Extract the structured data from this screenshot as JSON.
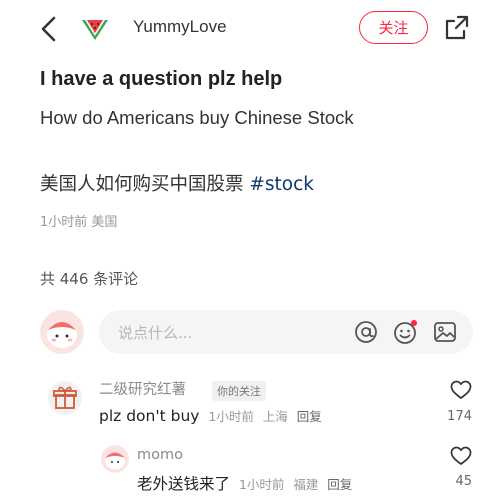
{
  "header": {
    "author_name": "YummyLove",
    "follow_label": "关注",
    "icons": [
      "chevron-left-icon",
      "watermelon-avatar",
      "share-icon"
    ]
  },
  "post": {
    "title": "I have a question plz help",
    "line1": "How do Americans buy Chinese Stock",
    "line2": "美国人如何购买中国股票",
    "hashtag": "#stock",
    "meta": "1小时前 美国"
  },
  "comments_section": {
    "count_label": "共 446 条评论",
    "input_placeholder": "说点什么...",
    "input_icons": [
      "at-icon",
      "emoji-icon",
      "image-icon"
    ],
    "accent_color": "#ff2442",
    "comments": [
      {
        "name": "二级研究红薯",
        "tag": "你的关注",
        "text": "plz don't buy",
        "time": "1小时前",
        "location": "上海",
        "reply_label": "回复",
        "likes": "174"
      },
      {
        "name": "momo",
        "text": "老外送钱来了",
        "time": "1小时前",
        "location": "福建",
        "reply_label": "回复",
        "likes": "45"
      }
    ]
  }
}
